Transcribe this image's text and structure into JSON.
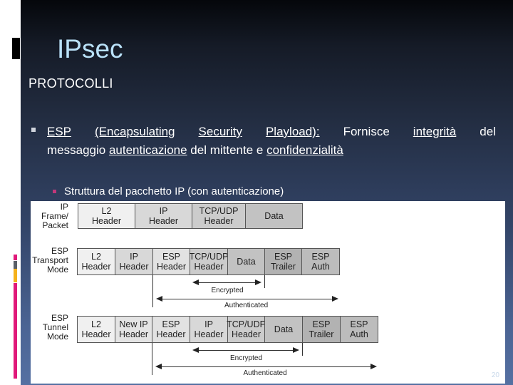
{
  "slide": {
    "title": "IPsec",
    "subtitle": "PROTOCOLLI",
    "bullet": {
      "line1_parts": [
        "ESP",
        "(Encapsulating",
        "Security",
        "Playload):",
        "Fornisce",
        "integrità",
        "del"
      ],
      "line2_parts": [
        "messaggio ",
        "autenticazione",
        " del mittente e ",
        "confidenzialità"
      ]
    },
    "sub_bullet": "Struttura del pacchetto IP (con autenticazione)",
    "page_number": "20",
    "colors": {
      "title": "#b9e1f8",
      "accent_pink": "#e0197a",
      "accent_gray": "#5a6068",
      "accent_gold": "#f5b21b"
    }
  },
  "diagram": {
    "rows": [
      {
        "label": [
          "IP",
          "Frame/",
          "Packet"
        ],
        "cells": [
          {
            "text": [
              "L2",
              "Header"
            ],
            "fill": "#f0f0f0"
          },
          {
            "text": [
              "IP",
              "Header"
            ],
            "fill": "#d8d8d8"
          },
          {
            "text": [
              "TCP/UDP",
              "Header"
            ],
            "fill": "#cccccc"
          },
          {
            "text": [
              "Data"
            ],
            "fill": "#c2c2c2"
          }
        ]
      },
      {
        "label": [
          "ESP",
          "Transport",
          "Mode"
        ],
        "cells": [
          {
            "text": [
              "L2",
              "Header"
            ],
            "fill": "#f0f0f0"
          },
          {
            "text": [
              "IP",
              "Header"
            ],
            "fill": "#d8d8d8"
          },
          {
            "text": [
              "ESP",
              "Header"
            ],
            "fill": "#e2e2e2"
          },
          {
            "text": [
              "TCP/UDP",
              "Header"
            ],
            "fill": "#cccccc"
          },
          {
            "text": [
              "Data"
            ],
            "fill": "#c2c2c2"
          },
          {
            "text": [
              "ESP",
              "Trailer"
            ],
            "fill": "#b2b2b2"
          },
          {
            "text": [
              "ESP",
              "Auth"
            ],
            "fill": "#bcbcbc"
          }
        ],
        "encrypted_label": "Encrypted",
        "authenticated_label": "Authenticated"
      },
      {
        "label": [
          "ESP",
          "Tunnel",
          "Mode"
        ],
        "cells": [
          {
            "text": [
              "L2",
              "Header"
            ],
            "fill": "#f0f0f0"
          },
          {
            "text": [
              "New IP",
              "Header"
            ],
            "fill": "#e4e4e4"
          },
          {
            "text": [
              "ESP",
              "Header"
            ],
            "fill": "#e2e2e2"
          },
          {
            "text": [
              "IP",
              "Header"
            ],
            "fill": "#d8d8d8"
          },
          {
            "text": [
              "TCP/UDP",
              "Header"
            ],
            "fill": "#cccccc"
          },
          {
            "text": [
              "Data"
            ],
            "fill": "#c2c2c2"
          },
          {
            "text": [
              "ESP",
              "Trailer"
            ],
            "fill": "#b2b2b2"
          },
          {
            "text": [
              "ESP",
              "Auth"
            ],
            "fill": "#bcbcbc"
          }
        ],
        "encrypted_label": "Encrypted",
        "authenticated_label": "Authenticated"
      }
    ]
  }
}
